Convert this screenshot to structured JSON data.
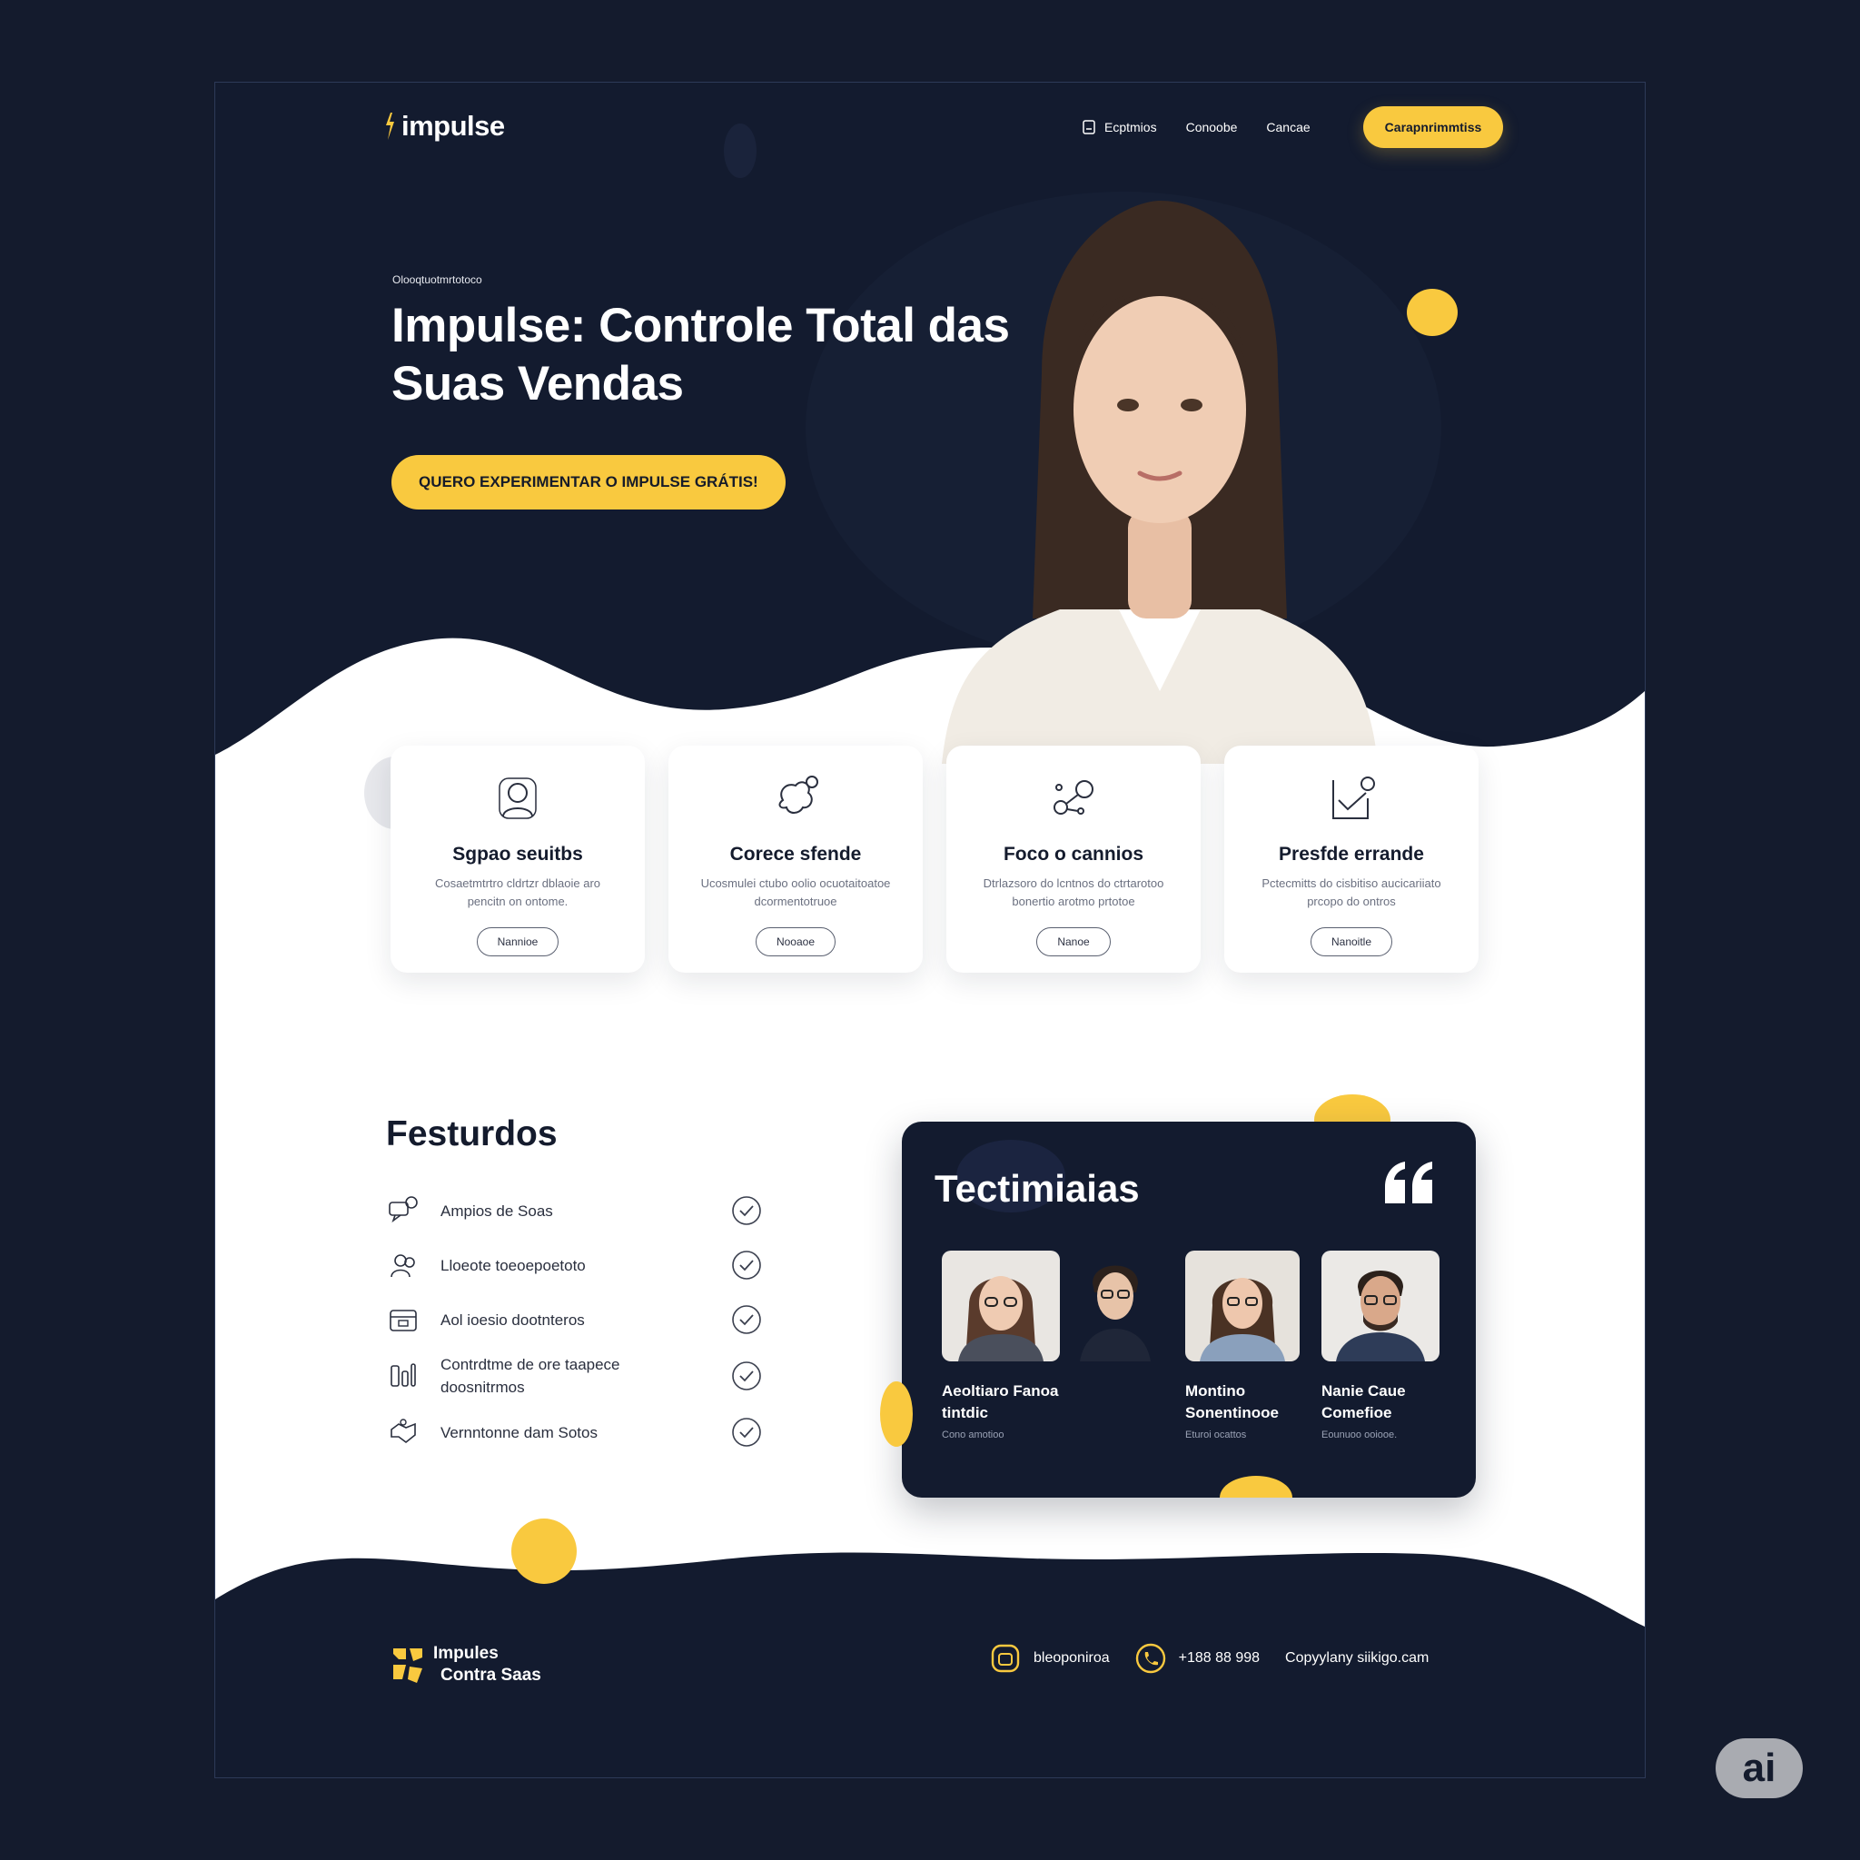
{
  "brand": {
    "name": "impulse",
    "accent": "#f9c93f",
    "dark": "#131b2f"
  },
  "nav": {
    "items": [
      {
        "label": "Ecptmios",
        "icon": "document-icon"
      },
      {
        "label": "Conoobe"
      },
      {
        "label": "Cancae"
      }
    ],
    "cta": "Carapnrimmtiss"
  },
  "hero": {
    "eyebrow": "Olooqtuotmrtotoco",
    "title": "Impulse: Controle Total das Suas Vendas",
    "cta": "QUERO EXPERIMENTAR O IMPULSE GRÁTIS!"
  },
  "cards": [
    {
      "icon": "user-icon",
      "title": "Sgpao seuitbs",
      "desc": "Cosaetmtrtro cldrtzr dblaoie aro pencitn on ontome.",
      "button": "Nannioe"
    },
    {
      "icon": "brain-icon",
      "title": "Corece sfende",
      "desc": "Ucosmulei ctubo oolio ocuotaitoatoe dcormentotruoe",
      "button": "Nooaoe"
    },
    {
      "icon": "network-icon",
      "title": "Foco o cannios",
      "desc": "Dtrlazsoro do lcntnos do ctrtarotoo bonertio arotmo prtotoe",
      "button": "Nanoe"
    },
    {
      "icon": "inbox-check-icon",
      "title": "Presfde errande",
      "desc": "Pctecmitts do cisbitiso aucicariiato prcopo do ontros",
      "button": "Nanoitle"
    }
  ],
  "features": {
    "title": "Festurdos",
    "items": [
      {
        "icon": "chat-icon",
        "label": "Ampios de Soas"
      },
      {
        "icon": "users-icon",
        "label": "Lloeote toeoepoetoto"
      },
      {
        "icon": "calendar-icon",
        "label": "Aol ioesio dootnteros"
      },
      {
        "icon": "chart-icon",
        "label": "Contrdtme de ore taapece doosnitrmos"
      },
      {
        "icon": "handshake-icon",
        "label": "Vernntonne dam Sotos"
      }
    ]
  },
  "testimonials": {
    "title": "Tectimiaias",
    "people": [
      {
        "name": "Aeoltiaro Fanoa tintdic",
        "role": "Cono amotioo",
        "photo": "woman-glasses"
      },
      {
        "name": "",
        "role": "",
        "photo": "man-glasses"
      },
      {
        "name": "Montino Sonentinooe",
        "role": "Eturoi ocattos",
        "photo": "woman-smiling"
      },
      {
        "name": "Nanie Caue Comefioe",
        "role": "Eounuoo ooiooe.",
        "photo": "man-beard"
      }
    ]
  },
  "footer": {
    "brand_line1": "Impules",
    "brand_line2": "Contra Saas",
    "email": "bleoponiroa",
    "phone": "+188 88 998",
    "copyright": "Copyylany siikigo.cam"
  },
  "badge": "ai"
}
